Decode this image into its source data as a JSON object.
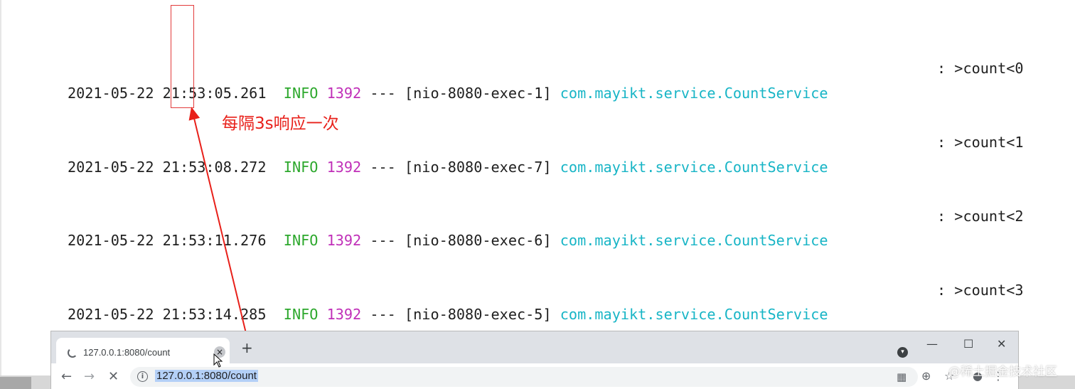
{
  "console": {
    "lines": [
      {
        "timestamp": "2021-05-22 21:53:05.261",
        "level": "INFO",
        "pid": "1392",
        "sep": "---",
        "thread": "[nio-8080-exec-1]",
        "logger": "com.mayikt.service.CountService",
        "message": ": >count<0"
      },
      {
        "timestamp": "2021-05-22 21:53:08.272",
        "level": "INFO",
        "pid": "1392",
        "sep": "---",
        "thread": "[nio-8080-exec-7]",
        "logger": "com.mayikt.service.CountService",
        "message": ": >count<1"
      },
      {
        "timestamp": "2021-05-22 21:53:11.276",
        "level": "INFO",
        "pid": "1392",
        "sep": "---",
        "thread": "[nio-8080-exec-6]",
        "logger": "com.mayikt.service.CountService",
        "message": ": >count<2"
      },
      {
        "timestamp": "2021-05-22 21:53:14.285",
        "level": "INFO",
        "pid": "1392",
        "sep": "---",
        "thread": "[nio-8080-exec-5]",
        "logger": "com.mayikt.service.CountService",
        "message": ": >count<3"
      }
    ]
  },
  "annotation": {
    "text": "每隔3s响应一次",
    "color": "#e8201a"
  },
  "browser": {
    "tab_title": "127.0.0.1:8080/count",
    "tab_close": "×",
    "new_tab": "+",
    "url": "127.0.0.1:8080/count",
    "window_controls": {
      "minimize": "—",
      "maximize": "☐",
      "close": "✕"
    },
    "nav": {
      "back": "←",
      "forward": "→",
      "stop": "✕"
    },
    "icons": [
      "info-icon",
      "qr-code-icon",
      "zoom-icon",
      "star-icon",
      "profile-icon",
      "menu-icon",
      "tab-search-icon",
      "loading-spinner-icon"
    ]
  },
  "watermark": "@稀土掘金技术社区",
  "colors": {
    "info_level": "#2da82d",
    "pid": "#c02fb8",
    "logger": "#18b5c6",
    "highlight": "#e23b3b"
  }
}
